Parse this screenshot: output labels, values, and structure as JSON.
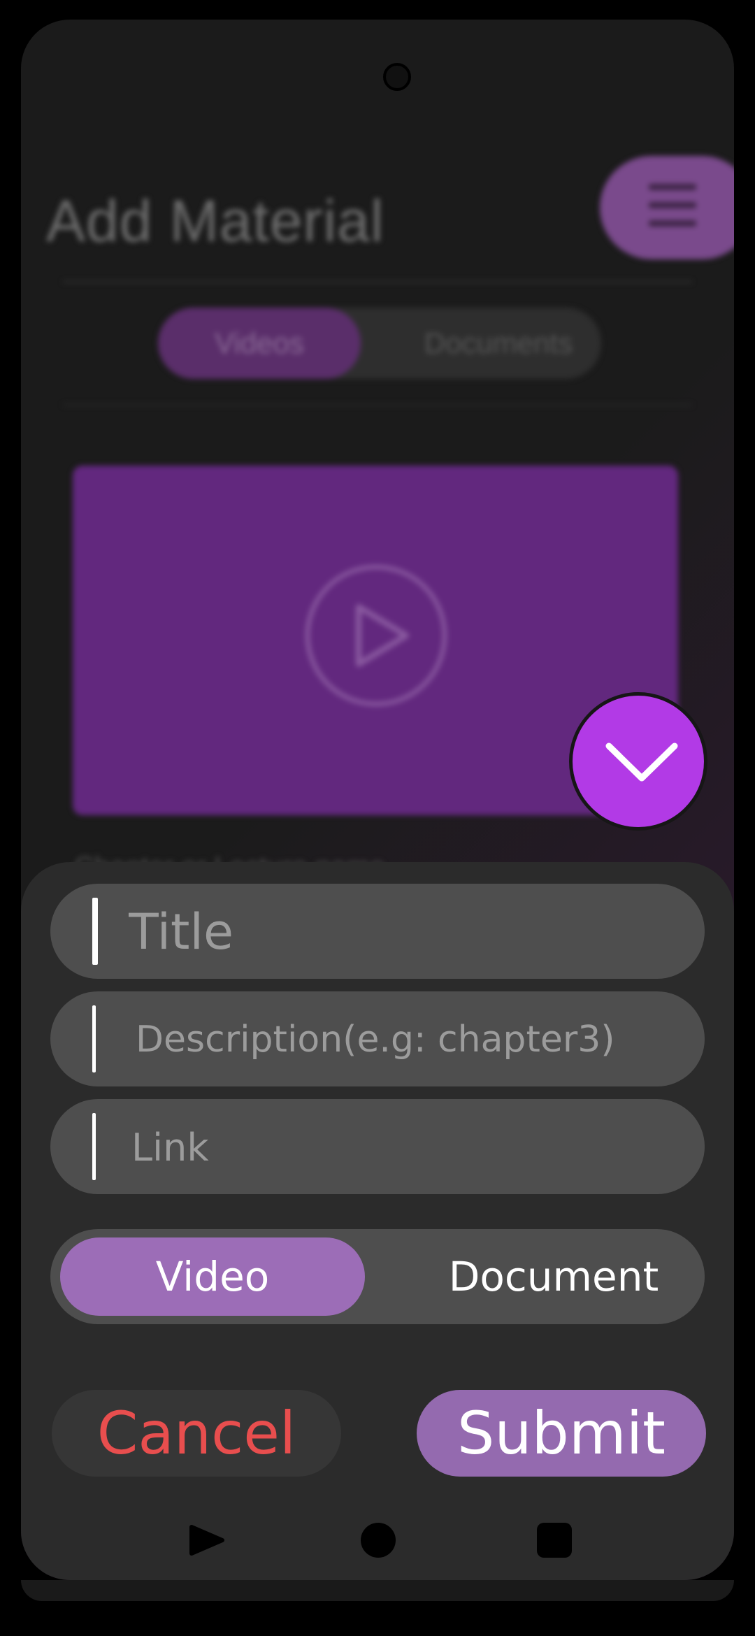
{
  "app": {
    "title": "Add Material",
    "menu_icon": "hamburger-icon"
  },
  "tabs": [
    {
      "label": "Videos",
      "active": true
    },
    {
      "label": "Documents",
      "active": false
    }
  ],
  "video_card": {
    "caption": "Chapter or Lecture name",
    "play_icon": "play-circle-icon",
    "thumbnail_color": "#62287e"
  },
  "fab": {
    "icon": "chevron-down-icon",
    "color": "#b23ae6"
  },
  "form": {
    "title_placeholder": "Title",
    "description_placeholder": "Description(e.g: chapter3)",
    "link_placeholder": "Link",
    "type_options": [
      {
        "label": "Video",
        "selected": true
      },
      {
        "label": "Document",
        "selected": false
      }
    ],
    "cancel_label": "Cancel",
    "submit_label": "Submit"
  },
  "colors": {
    "accent": "#946aaf",
    "cancel_text": "#e84e4e"
  },
  "nav": {
    "back_icon": "back-triangle-icon",
    "home_icon": "home-circle-icon",
    "recents_icon": "recents-square-icon"
  }
}
